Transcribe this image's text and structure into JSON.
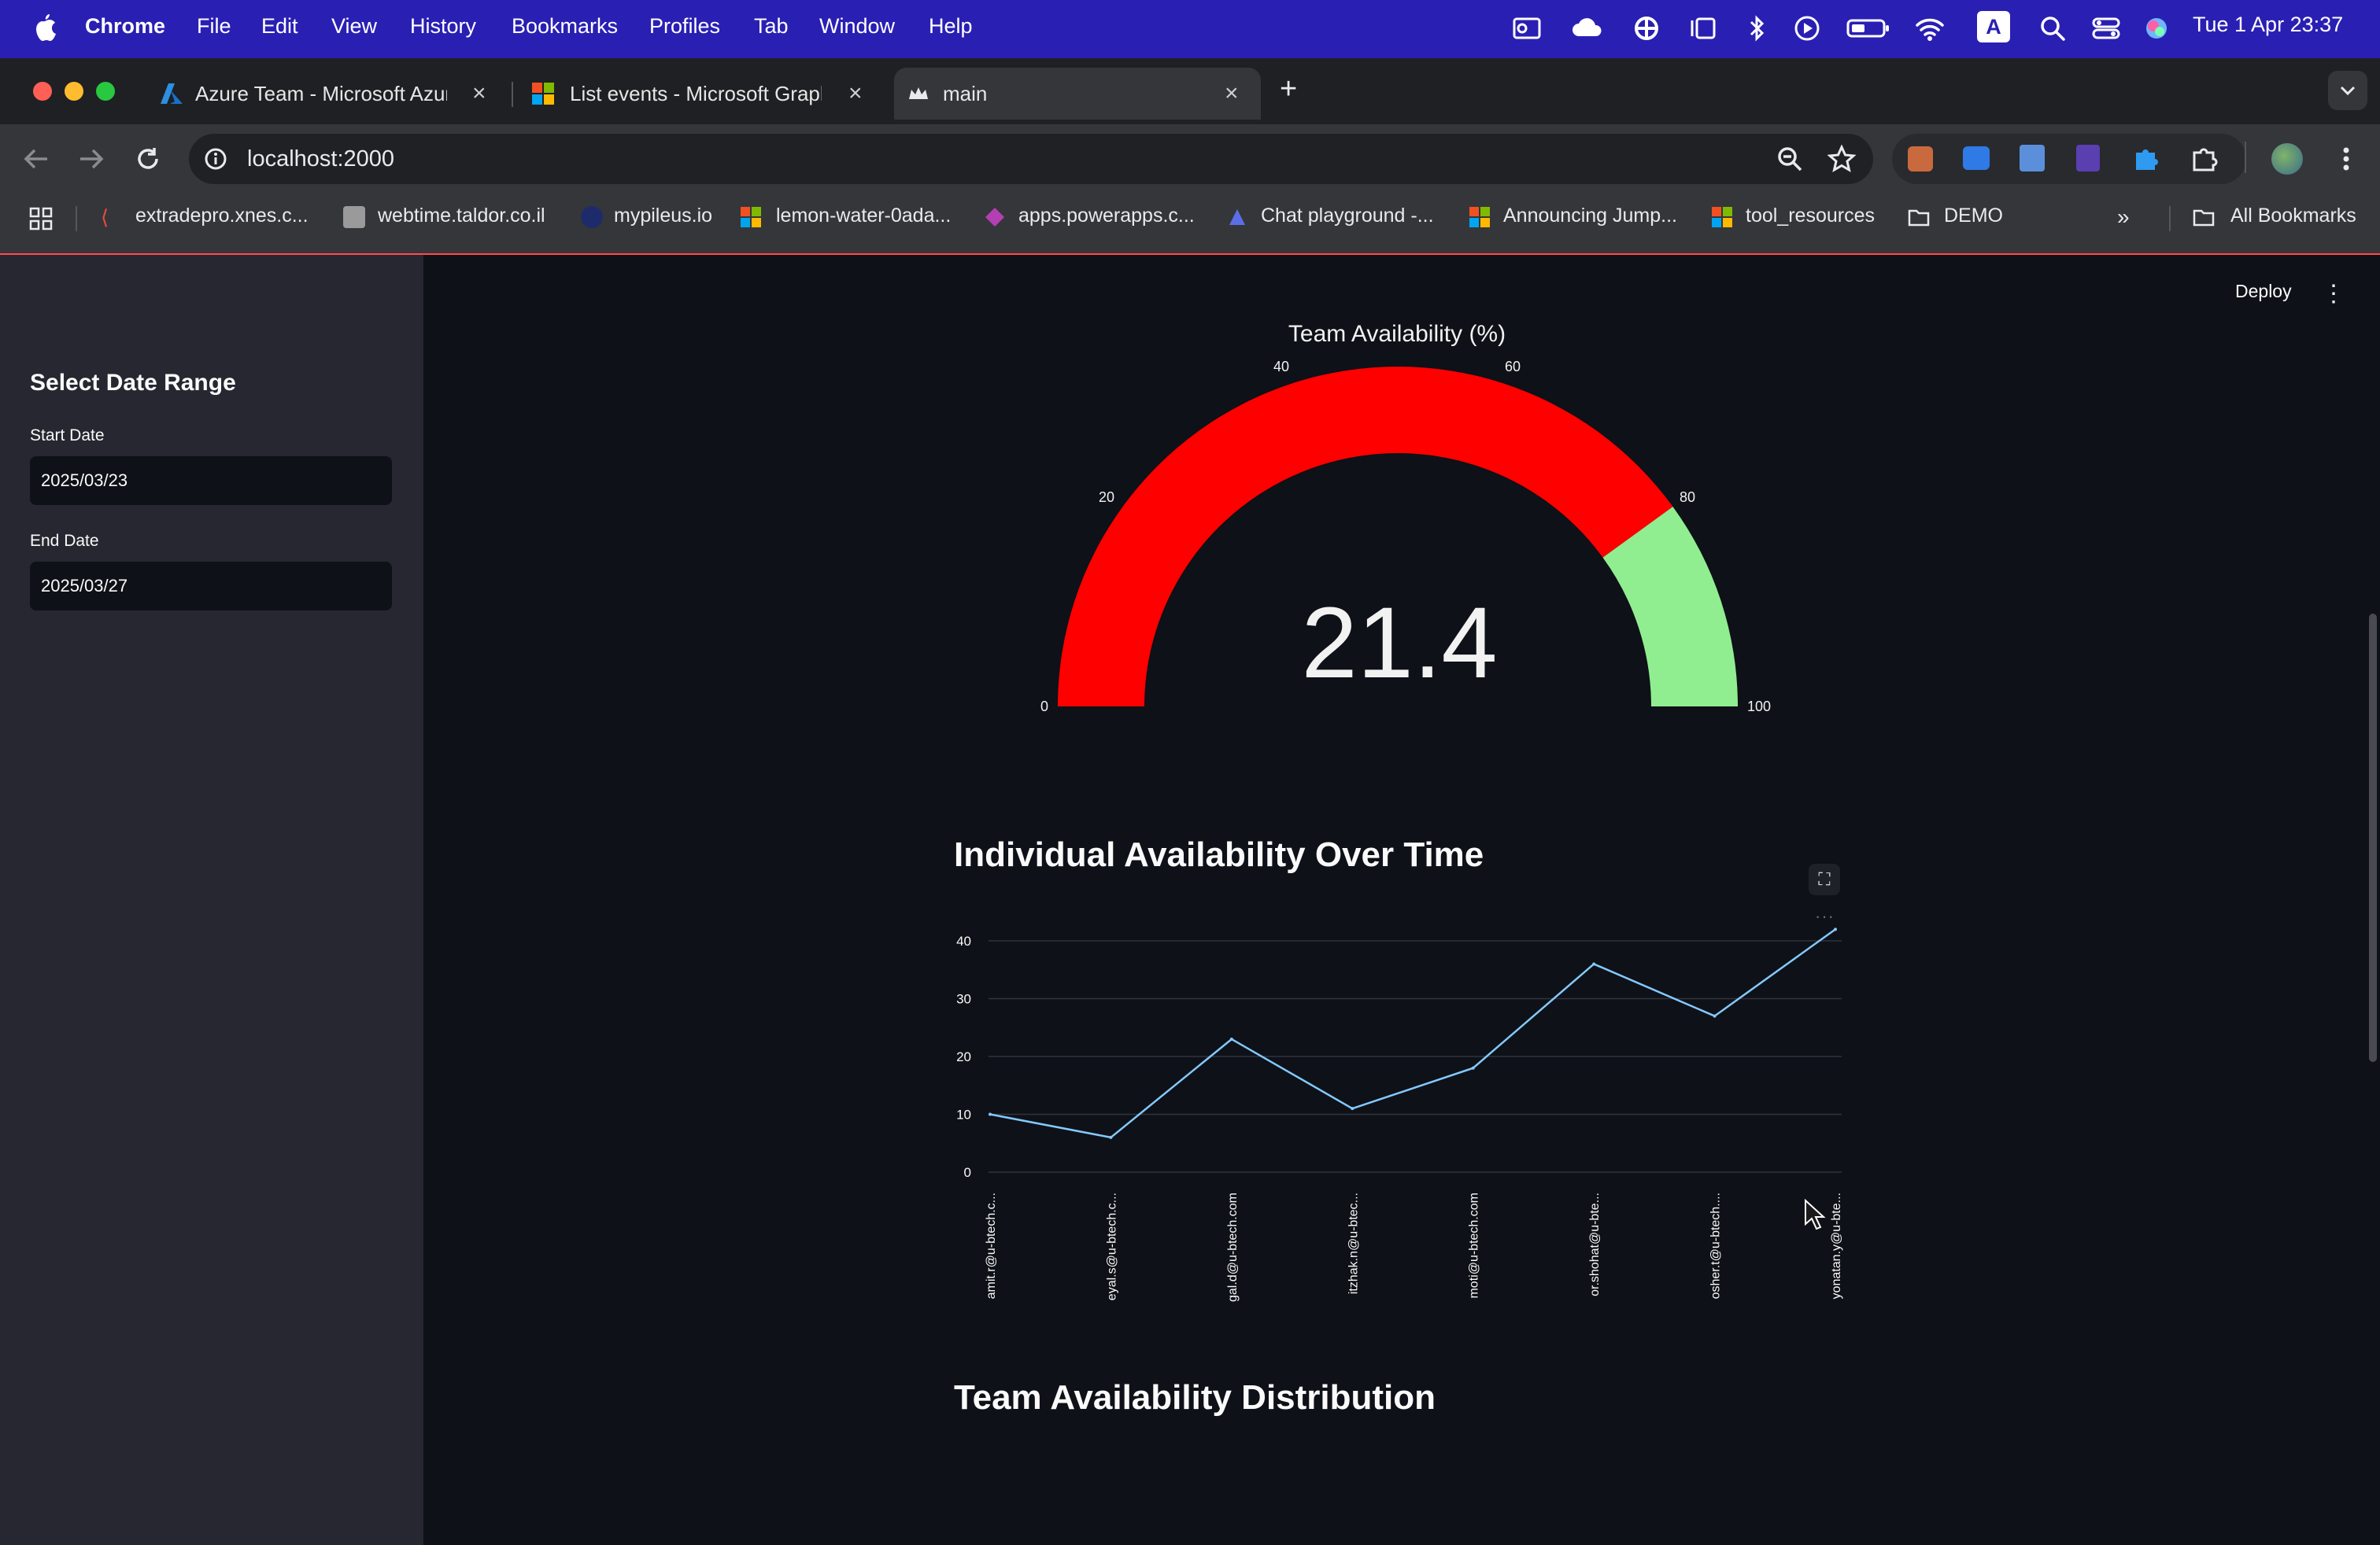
{
  "menubar": {
    "app": "Chrome",
    "items": [
      "File",
      "Edit",
      "View",
      "History",
      "Bookmarks",
      "Profiles",
      "Tab",
      "Window",
      "Help"
    ],
    "clock": "Tue 1 Apr  23:37",
    "input_source": "A"
  },
  "browser": {
    "tabs": [
      {
        "title": "Azure Team - Microsoft Azure",
        "icon": "azure-icon"
      },
      {
        "title": "List events - Microsoft Graph",
        "icon": "microsoft-icon"
      },
      {
        "title": "main",
        "icon": "streamlit-crown-icon"
      }
    ],
    "url": "localhost:2000",
    "bookmarks": [
      "extradepro.xnes.c...",
      "webtime.taldor.co.il",
      "mypileus.io",
      "lemon-water-0ada...",
      "apps.powerapps.c...",
      "Chat playground -...",
      "Announcing Jump...",
      "tool_resources",
      "DEMO"
    ],
    "all_bookmarks": "All Bookmarks"
  },
  "app": {
    "deploy_label": "Deploy",
    "sidebar": {
      "title": "Select Date Range",
      "start_label": "Start Date",
      "start_value": "2025/03/23",
      "end_label": "End Date",
      "end_value": "2025/03/27"
    },
    "gauge": {
      "title": "Team Availability (%)",
      "value": "21.4",
      "ticks": [
        "0",
        "20",
        "40",
        "60",
        "80",
        "100"
      ],
      "steps": [
        {
          "range": [
            0,
            80
          ],
          "color": "#ff0000"
        },
        {
          "range": [
            80,
            100
          ],
          "color": "#90ee90"
        }
      ]
    },
    "line_chart_title": "Individual Availability Over Time",
    "distribution_title": "Team Availability Distribution"
  },
  "chart_data": {
    "type": "line",
    "categories": [
      "amit.r@u-btech.c...",
      "eyal.s@u-btech.c...",
      "gal.d@u-btech.com",
      "itzhak.n@u-btec...",
      "moti@u-btech.com",
      "or.shohat@u-bte...",
      "osher.t@u-btech....",
      "yonatan.y@u-bte..."
    ],
    "values": [
      10,
      6,
      23,
      11,
      18,
      36,
      27,
      42
    ],
    "yticks": [
      "0",
      "10",
      "20",
      "30",
      "40"
    ],
    "ylim": [
      0,
      43
    ],
    "line_color": "#83c9ff",
    "grid": true
  }
}
